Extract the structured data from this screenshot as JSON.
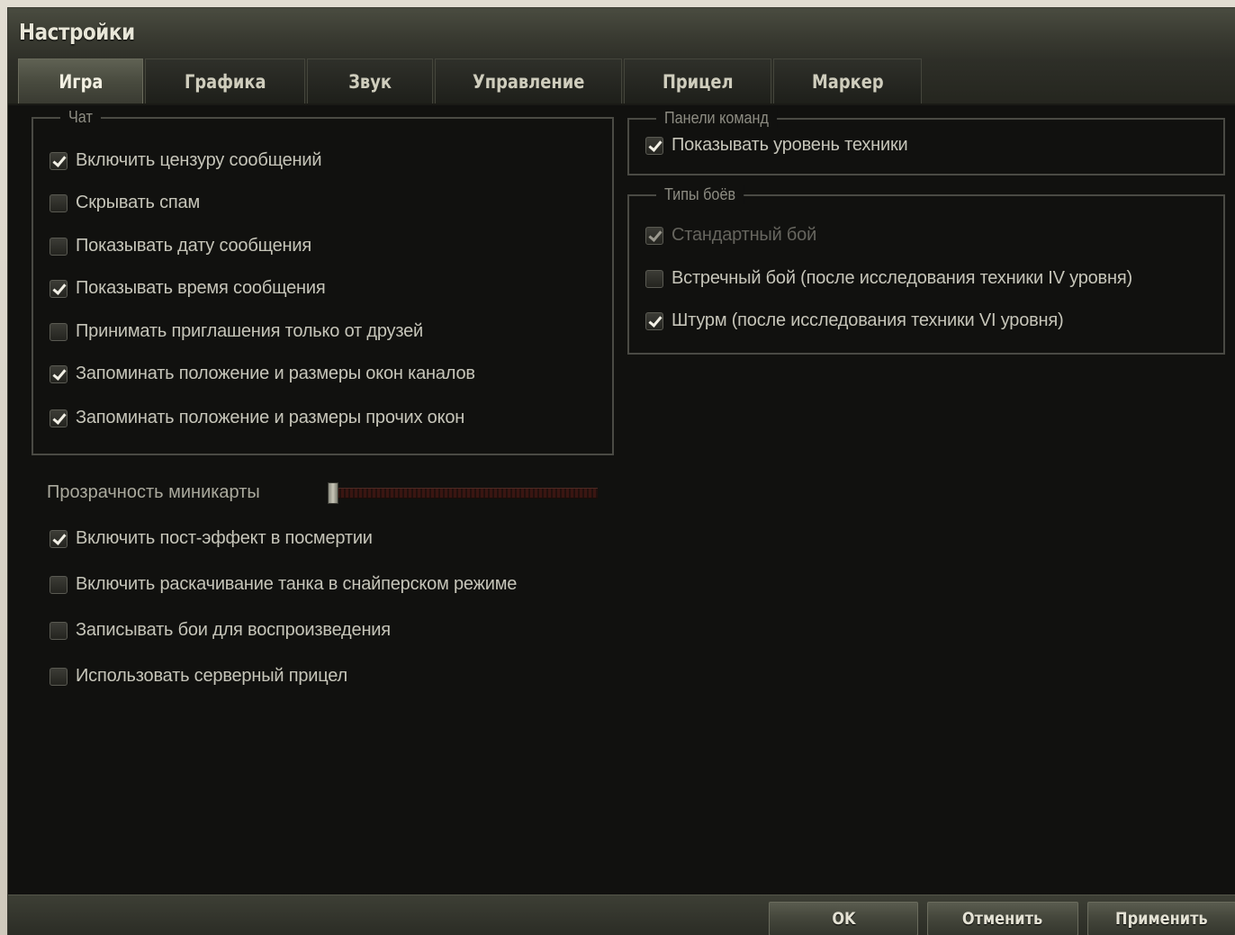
{
  "window": {
    "title": "Настройки"
  },
  "tabs": [
    {
      "label": "Игра",
      "active": true
    },
    {
      "label": "Графика",
      "active": false
    },
    {
      "label": "Звук",
      "active": false
    },
    {
      "label": "Управление",
      "active": false
    },
    {
      "label": "Прицел",
      "active": false
    },
    {
      "label": "Маркер",
      "active": false
    }
  ],
  "chat": {
    "legend": "Чат",
    "options": [
      {
        "label": "Включить цензуру сообщений",
        "checked": true
      },
      {
        "label": "Скрывать спам",
        "checked": false
      },
      {
        "label": "Показывать дату сообщения",
        "checked": false
      },
      {
        "label": "Показывать время сообщения",
        "checked": true
      },
      {
        "label": "Принимать приглашения только от друзей",
        "checked": false
      },
      {
        "label": "Запоминать положение и размеры окон каналов",
        "checked": true
      },
      {
        "label": "Запоминать положение и размеры прочих окон",
        "checked": true
      }
    ]
  },
  "minimap": {
    "label": "Прозрачность миникарты",
    "value_fraction": 0.0
  },
  "general": {
    "options": [
      {
        "label": "Включить пост-эффект в посмертии",
        "checked": true
      },
      {
        "label": "Включить раскачивание танка в снайперском режиме",
        "checked": false
      },
      {
        "label": "Записывать бои для воспроизведения",
        "checked": false
      },
      {
        "label": "Использовать серверный прицел",
        "checked": false
      }
    ]
  },
  "team_panels": {
    "legend": "Панели команд",
    "options": [
      {
        "label": "Показывать уровень техники",
        "checked": true
      }
    ]
  },
  "battle_types": {
    "legend": "Типы боёв",
    "options": [
      {
        "label": "Стандартный бой",
        "checked": true,
        "disabled": true
      },
      {
        "label": "Встречный бой (после исследования техники IV уровня)",
        "checked": false,
        "disabled": false
      },
      {
        "label": "Штурм (после исследования техники VI уровня)",
        "checked": true,
        "disabled": false
      }
    ]
  },
  "footer": {
    "ok_label": "OK",
    "cancel_label": "Отменить",
    "apply_label": "Применить"
  },
  "colors": {
    "window_bg": "#121210",
    "text": "#c6c5b9",
    "legend": "#8d8c82",
    "disabled_text": "#66655e",
    "slider_track": "#3a1612"
  }
}
